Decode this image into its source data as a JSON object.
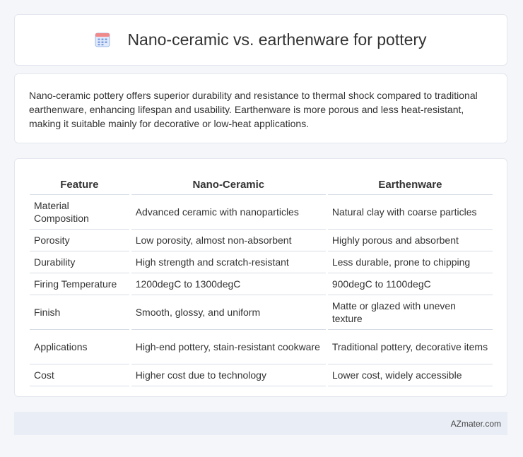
{
  "header": {
    "title": "Nano-ceramic vs. earthenware for pottery",
    "icon": "calendar-grid-icon"
  },
  "summary": {
    "text": "Nano-ceramic pottery offers superior durability and resistance to thermal shock compared to traditional earthenware, enhancing lifespan and usability. Earthenware is more porous and less heat-resistant, making it suitable mainly for decorative or low-heat applications."
  },
  "table": {
    "headers": [
      "Feature",
      "Nano-Ceramic",
      "Earthenware"
    ],
    "rows": [
      [
        "Material Composition",
        "Advanced ceramic with nanoparticles",
        "Natural clay with coarse particles"
      ],
      [
        "Porosity",
        "Low porosity, almost non-absorbent",
        "Highly porous and absorbent"
      ],
      [
        "Durability",
        "High strength and scratch-resistant",
        "Less durable, prone to chipping"
      ],
      [
        "Firing Temperature",
        "1200degC to 1300degC",
        "900degC to 1100degC"
      ],
      [
        "Finish",
        "Smooth, glossy, and uniform",
        "Matte or glazed with uneven texture"
      ],
      [
        "Applications",
        "High-end pottery, stain-resistant cookware",
        "Traditional pottery, decorative items"
      ],
      [
        "Cost",
        "Higher cost due to technology",
        "Lower cost, widely accessible"
      ]
    ]
  },
  "footer": {
    "site": "AZmater.com"
  },
  "colors": {
    "background": "#f4f6f9",
    "card": "#ffffff",
    "footer": "#e9eef6",
    "icon_top": "#f07a7a",
    "icon_body": "#7da4e6"
  }
}
